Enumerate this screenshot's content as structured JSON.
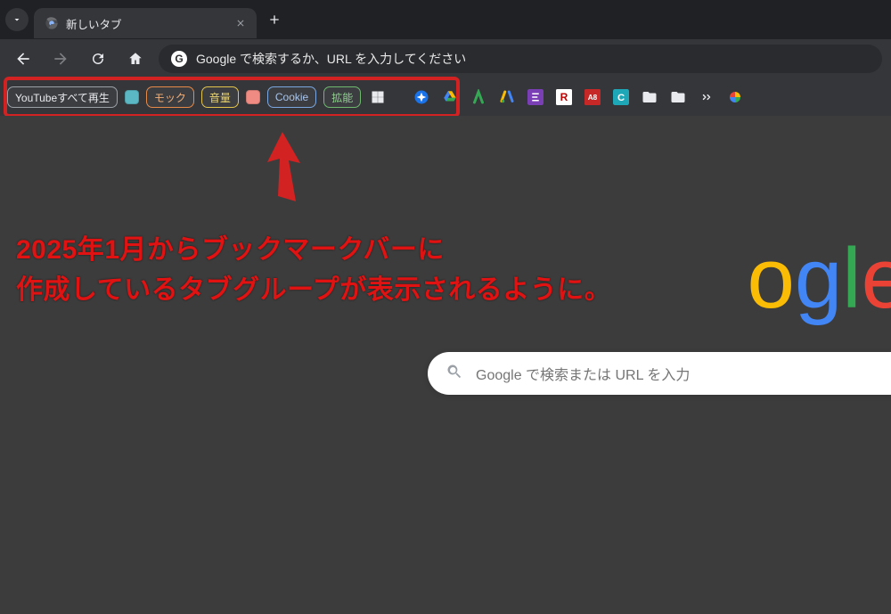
{
  "tabStrip": {
    "tabs": [
      {
        "title": "新しいタブ"
      }
    ]
  },
  "toolbar": {
    "omniboxPlaceholder": "Google で検索するか、URL を入力してください"
  },
  "bookmarksBar": {
    "tabGroups": [
      {
        "label": "YouTubeすべて再生",
        "color": "#9aa0a6",
        "textColor": "#e8eaed"
      },
      {
        "dotOnly": true,
        "color": "#5bb7c4"
      },
      {
        "label": "モック",
        "color": "#e68a4a",
        "textColor": "#f0b07d"
      },
      {
        "label": "音量",
        "color": "#e2c44d",
        "textColor": "#e8d26f"
      },
      {
        "dotOnly": true,
        "color": "#ef8b82"
      },
      {
        "label": "Cookie",
        "color": "#7aa7e0",
        "textColor": "#a9c4ea"
      },
      {
        "label": "拡能",
        "color": "#6fb96f",
        "textColor": "#8fd08f"
      }
    ],
    "highlightWidth": 512
  },
  "annotation": {
    "line1": "2025年1月からブックマークバーに",
    "line2": "作成しているタブグループが表示されるように。"
  },
  "search": {
    "placeholder": "Google で検索または URL を入力"
  },
  "googleColors": {
    "G": "#4285F4",
    "o1": "#EA4335",
    "o2": "#FBBC05",
    "g": "#4285F4",
    "l": "#34A853",
    "e": "#EA4335"
  }
}
